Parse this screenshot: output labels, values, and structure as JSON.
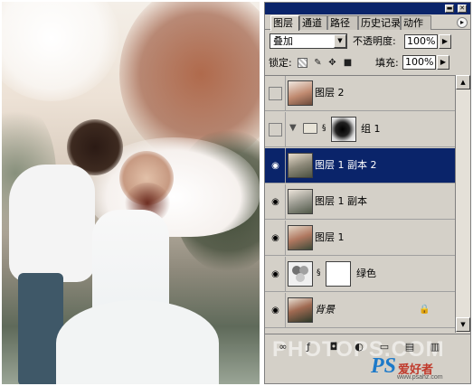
{
  "panel": {
    "tabs": [
      "图层",
      "通道",
      "路径",
      "历史记录",
      "动作"
    ],
    "blend_mode": "叠加",
    "opacity_label": "不透明度:",
    "opacity_value": "100%",
    "lock_label": "锁定:",
    "fill_label": "填充:",
    "fill_value": "100%"
  },
  "layers": [
    {
      "name": "图层 2",
      "visible": false,
      "selected": false
    },
    {
      "name": "组 1",
      "visible": false,
      "selected": false,
      "group": true
    },
    {
      "name": "图层 1 副本 2",
      "visible": true,
      "selected": true
    },
    {
      "name": "图层 1 副本",
      "visible": true,
      "selected": false
    },
    {
      "name": "图层 1",
      "visible": true,
      "selected": false
    },
    {
      "name": "绿色",
      "visible": true,
      "selected": false,
      "adjustment": true
    },
    {
      "name": "背景",
      "visible": true,
      "selected": false,
      "locked": true
    }
  ],
  "watermark": "PHOTOPS.COM",
  "brand": {
    "ps": "PS",
    "cn": "爱好者",
    "url": "www.psahz.com"
  },
  "colors": {
    "titlebar": "#0a246a",
    "panel_bg": "#d4d0c8",
    "selection": "#0a246a",
    "brand_blue": "#1c79c9",
    "brand_red": "#c0392b"
  }
}
